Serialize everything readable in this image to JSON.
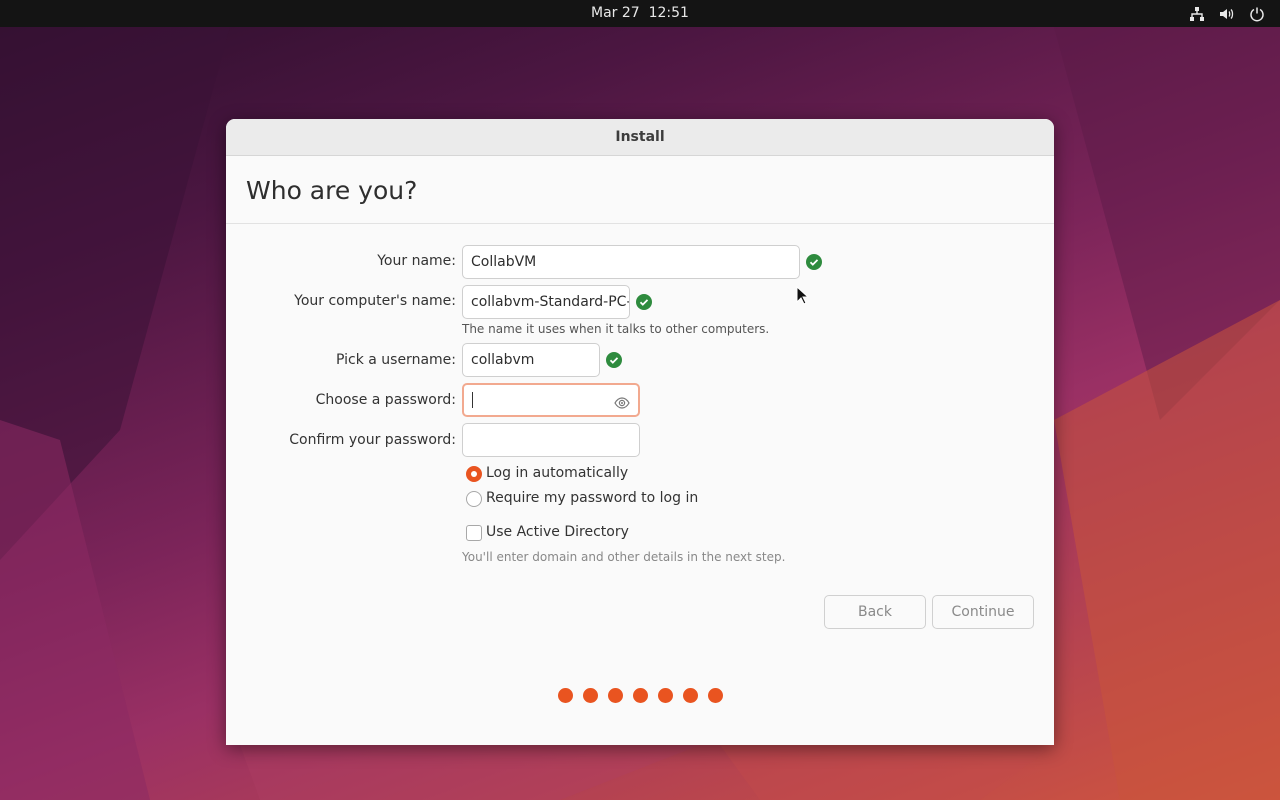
{
  "topbar": {
    "date": "Mar 27",
    "time": "12:51",
    "tray_icons": [
      "network-icon",
      "volume-icon",
      "power-icon"
    ]
  },
  "window": {
    "title": "Install",
    "heading": "Who are you?"
  },
  "form": {
    "name_label": "Your name:",
    "name_value": "CollabVM",
    "computer_label": "Your computer's name:",
    "computer_value": "collabvm-Standard-PC-",
    "computer_hint": "The name it uses when it talks to other computers.",
    "username_label": "Pick a username:",
    "username_value": "collabvm",
    "password_label": "Choose a password:",
    "password_value": "",
    "confirm_label": "Confirm your password:",
    "confirm_value": "",
    "login_auto_label": "Log in automatically",
    "login_auto_selected": true,
    "require_password_label": "Require my password to log in",
    "active_directory_label": "Use Active Directory",
    "active_directory_checked": false,
    "active_directory_hint": "You'll enter domain and other details in the next step."
  },
  "buttons": {
    "back": "Back",
    "continue": "Continue"
  },
  "progress": {
    "steps_total": 7,
    "steps_done": 7
  },
  "colors": {
    "accent": "#e95420",
    "valid": "#2e8b3e",
    "topbar": "#141414"
  }
}
